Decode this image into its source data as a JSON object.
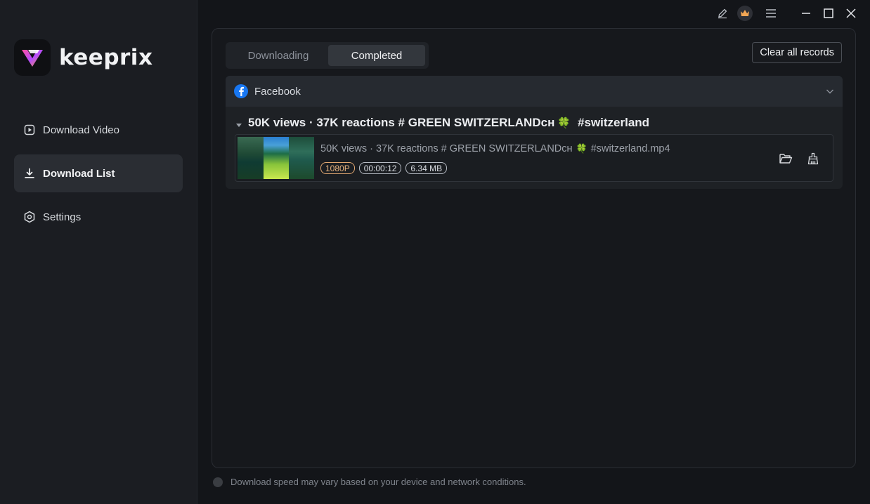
{
  "app": {
    "name": "keeprix"
  },
  "sidebar": {
    "items": [
      {
        "label": "Download Video",
        "icon": "play-square-icon"
      },
      {
        "label": "Download List",
        "icon": "download-icon"
      },
      {
        "label": "Settings",
        "icon": "gear-icon"
      }
    ]
  },
  "tabs": {
    "downloading": "Downloading",
    "completed": "Completed"
  },
  "toolbar": {
    "clear_label": "Clear all records"
  },
  "group": {
    "platform": "Facebook",
    "video_title": "50K views · 37K reactions # GREEN SWITZERLANDᴄʜ",
    "video_title_tail": "#switzerland",
    "clover": "🍀",
    "file": {
      "name_prefix": "50K views · 37K reactions # GREEN SWITZERLANDᴄʜ",
      "name_suffix": "#switzerland.mp4",
      "resolution": "1080P",
      "duration": "00:00:12",
      "size": "6.34 MB"
    }
  },
  "footer": {
    "note": "Download speed may vary based on your device and network conditions."
  },
  "colors": {
    "accent_resolution": "#e8b47f",
    "facebook": "#1877f2",
    "clover": "#27c24c"
  }
}
